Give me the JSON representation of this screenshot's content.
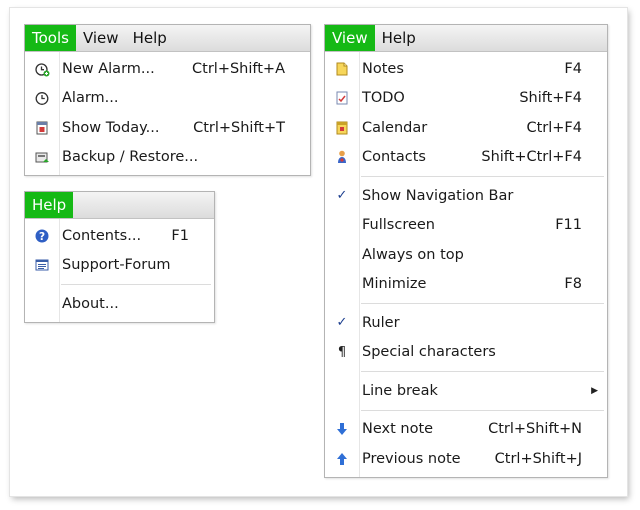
{
  "colors": {
    "menu_active": "#15b915"
  },
  "tools_menu": {
    "menubar": [
      "Tools",
      "View",
      "Help"
    ],
    "items": [
      {
        "icon": "alarm-add-icon",
        "label": "New Alarm...",
        "shortcut": "Ctrl+Shift+A"
      },
      {
        "icon": "alarm-clock-icon",
        "label": "Alarm...",
        "shortcut": ""
      },
      {
        "icon": "calendar-day-icon",
        "label": "Show Today...",
        "shortcut": "Ctrl+Shift+T"
      },
      {
        "icon": "backup-restore-icon",
        "label": "Backup / Restore...",
        "shortcut": ""
      }
    ]
  },
  "help_menu": {
    "menubar": [
      "Help"
    ],
    "items": [
      {
        "icon": "help-icon",
        "label": "Contents...",
        "shortcut": "F1"
      },
      {
        "icon": "forum-icon",
        "label": "Support-Forum",
        "shortcut": ""
      },
      {
        "icon": "",
        "label": "About...",
        "shortcut": ""
      }
    ]
  },
  "view_menu": {
    "menubar": [
      "View",
      "Help"
    ],
    "items": [
      {
        "icon": "notes-icon",
        "label": "Notes",
        "shortcut": "F4"
      },
      {
        "icon": "todo-icon",
        "label": "TODO",
        "shortcut": "Shift+F4"
      },
      {
        "icon": "calendar-icon",
        "label": "Calendar",
        "shortcut": "Ctrl+F4"
      },
      {
        "icon": "contacts-icon",
        "label": "Contacts",
        "shortcut": "Shift+Ctrl+F4"
      },
      {
        "icon": "checkmark-icon",
        "label": "Show Navigation Bar",
        "shortcut": "",
        "checked": true
      },
      {
        "icon": "",
        "label": "Fullscreen",
        "shortcut": "F11"
      },
      {
        "icon": "",
        "label": "Always on top",
        "shortcut": ""
      },
      {
        "icon": "",
        "label": "Minimize",
        "shortcut": "F8"
      },
      {
        "icon": "checkmark-icon",
        "label": "Ruler",
        "shortcut": "",
        "checked": true
      },
      {
        "icon": "pilcrow-icon",
        "label": "Special characters",
        "shortcut": ""
      },
      {
        "icon": "",
        "label": "Line break",
        "shortcut": "",
        "submenu": true
      },
      {
        "icon": "arrow-down-icon",
        "label": "Next note",
        "shortcut": "Ctrl+Shift+N"
      },
      {
        "icon": "arrow-up-icon",
        "label": "Previous note",
        "shortcut": "Ctrl+Shift+J"
      }
    ]
  }
}
